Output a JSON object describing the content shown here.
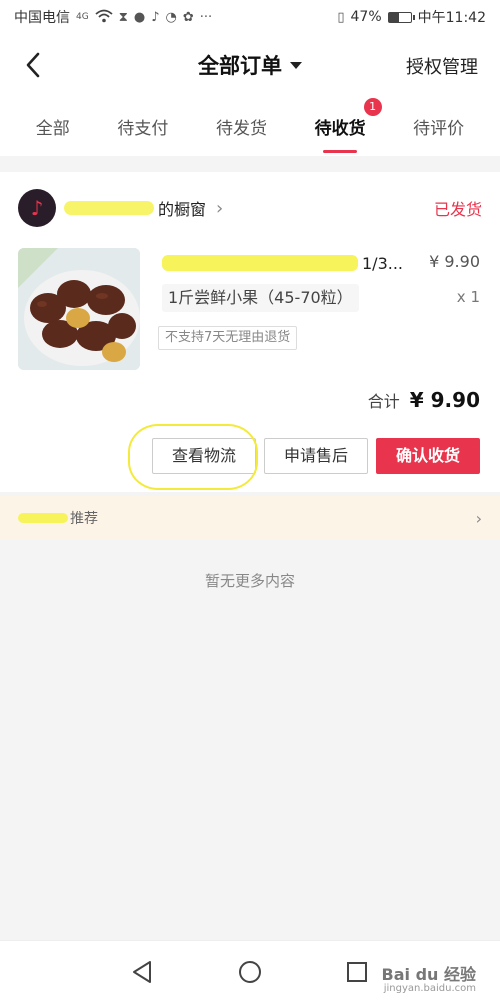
{
  "status_bar": {
    "carrier": "中国电信",
    "network": "4G",
    "battery": "47%",
    "battery_level": 0.47,
    "time": "中午11:42"
  },
  "header": {
    "title": "全部订单",
    "right_link": "授权管理"
  },
  "tabs": [
    {
      "label": "全部"
    },
    {
      "label": "待支付"
    },
    {
      "label": "待发货"
    },
    {
      "label": "待收货",
      "badge": "1",
      "active": true
    },
    {
      "label": "待评价"
    }
  ],
  "order": {
    "shop_suffix": "的橱窗",
    "status": "已发货",
    "product": {
      "title_suffix": "1/3...",
      "price": "¥ 9.90",
      "spec": "1斤尝鲜小果（45-70粒）",
      "qty": "x 1",
      "tag": "不支持7天无理由退货"
    },
    "total_label": "合计",
    "total_value": "¥ 9.90",
    "buttons": {
      "logistics": "查看物流",
      "aftersale": "申请售后",
      "confirm": "确认收货"
    }
  },
  "recommend": {
    "label": "推荐"
  },
  "empty_text": "暂无更多内容",
  "watermark": {
    "brand": "Bai du 经验",
    "sub": "jingyan.baidu.com"
  },
  "colors": {
    "accent": "#e8344d",
    "highlight": "#f3ea3b"
  }
}
